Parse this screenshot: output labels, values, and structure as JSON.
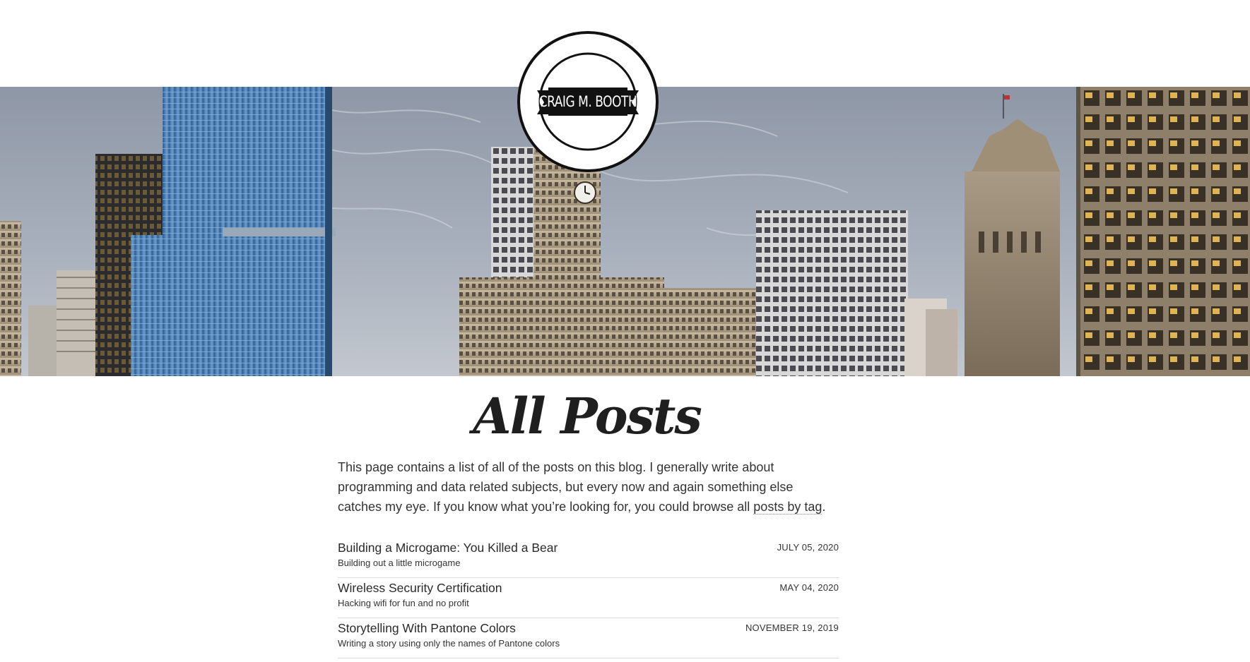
{
  "site": {
    "logo_text": "CRAIG M. BOOTH",
    "hero_alt": "Chicago skyline panorama"
  },
  "page": {
    "title": "All Posts",
    "intro_text": "This page contains a list of all of the posts on this blog. I generally write about programming and data related subjects, but every now and again something else catches my eye. If you know what you’re looking for, you could browse all ",
    "intro_link": "posts by tag",
    "intro_end": "."
  },
  "posts": [
    {
      "title": "Building a Microgame: You Killed a Bear",
      "subtitle": "Building out a little microgame",
      "date": "JULY 05, 2020"
    },
    {
      "title": "Wireless Security Certification",
      "subtitle": "Hacking wifi for fun and no profit",
      "date": "MAY 04, 2020"
    },
    {
      "title": "Storytelling With Pantone Colors",
      "subtitle": "Writing a story using only the names of Pantone colors",
      "date": "NOVEMBER 19, 2019"
    }
  ]
}
